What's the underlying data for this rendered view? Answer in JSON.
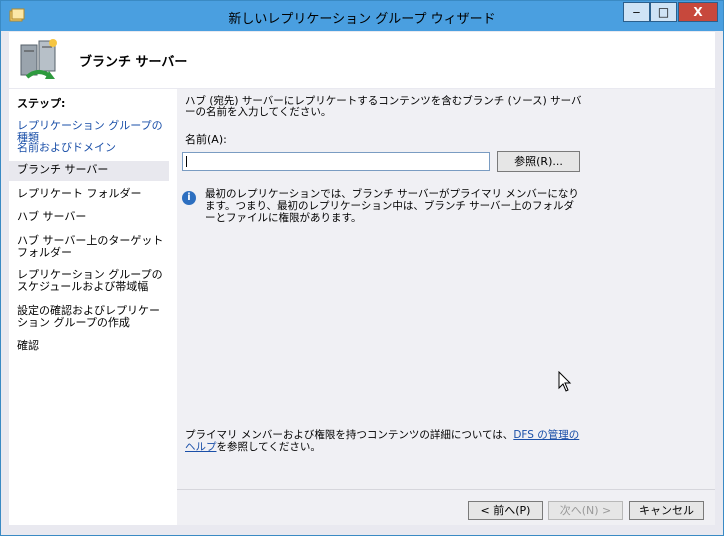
{
  "window": {
    "title": "新しいレプリケーション グループ ウィザード",
    "controls": {
      "minimize": "‒",
      "maximize": "□",
      "close": "X"
    }
  },
  "header": {
    "title": "ブランチ サーバー"
  },
  "sidebar": {
    "steps_label": "ステップ:",
    "items": [
      {
        "label": "レプリケーション グループの種類",
        "state": "link"
      },
      {
        "label": "名前およびドメイン",
        "state": "link"
      },
      {
        "label": "ブランチ サーバー",
        "state": "current"
      },
      {
        "label": "レプリケート フォルダー",
        "state": "normal"
      },
      {
        "label": "ハブ サーバー",
        "state": "normal"
      },
      {
        "label": "ハブ サーバー上のターゲット フォルダー",
        "state": "normal"
      },
      {
        "label": "レプリケーション グループのスケジュールおよび帯域幅",
        "state": "normal"
      },
      {
        "label": "設定の確認およびレプリケーション グループの作成",
        "state": "normal"
      },
      {
        "label": "確認",
        "state": "normal"
      }
    ]
  },
  "main": {
    "description": "ハブ (宛先) サーバーにレプリケートするコンテンツを含むブランチ (ソース) サーバーの名前を入力してください。",
    "name_label": "名前(A):",
    "name_value": "",
    "browse_label": "参照(R)...",
    "info_text": "最初のレプリケーションでは、ブランチ サーバーがプライマリ メンバーになります。つまり、最初のレプリケーション中は、ブランチ サーバー上のフォルダーとファイルに権限があります。",
    "footer_text_before": "プライマリ メンバーおよび権限を持つコンテンツの詳細については、",
    "footer_link": "DFS の管理のヘルプ",
    "footer_text_after": "を参照してください。"
  },
  "buttons": {
    "back": "< 前へ(P)",
    "next": "次へ(N) >",
    "cancel": "キャンセル"
  },
  "icons": {
    "app": "replication-app-icon",
    "header": "replication-servers-icon",
    "info": "info-icon",
    "cursor": "mouse-pointer-icon"
  },
  "colors": {
    "titlebar": "#4a9fe0",
    "link": "#1a4fa8",
    "close": "#c7483c"
  }
}
